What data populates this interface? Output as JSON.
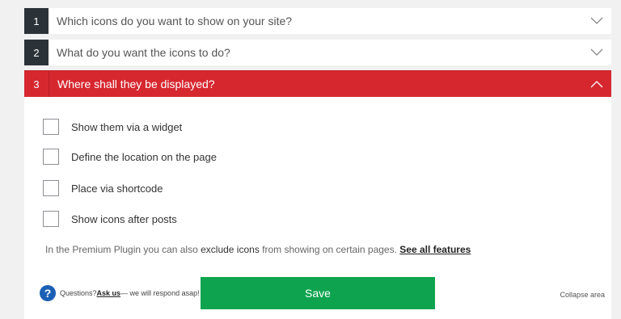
{
  "sections": [
    {
      "number": "1",
      "title": "Which icons do you want to show on your site?"
    },
    {
      "number": "2",
      "title": "What do you want the icons to do?"
    },
    {
      "number": "3",
      "title": "Where shall they be displayed?"
    }
  ],
  "options": [
    {
      "label": "Show them via a widget",
      "checked": false
    },
    {
      "label": "Define the location on the page",
      "checked": false
    },
    {
      "label": "Place via shortcode",
      "checked": false
    },
    {
      "label": "Show icons after posts",
      "checked": false
    }
  ],
  "premium_note": {
    "prefix": "In the Premium Plugin you can also ",
    "bold": "exclude icons",
    "suffix": " from showing on certain pages. ",
    "link": "See all features"
  },
  "help": {
    "icon": "?",
    "prefix": "Questions? ",
    "link": "Ask us",
    "suffix": " — we will respond asap!"
  },
  "save_label": "Save",
  "collapse_label": "Collapse area",
  "colors": {
    "active_section": "#d6272f",
    "save_button": "#0ea44f",
    "number_box": "#2c3338",
    "help_icon": "#1c5fb6"
  }
}
